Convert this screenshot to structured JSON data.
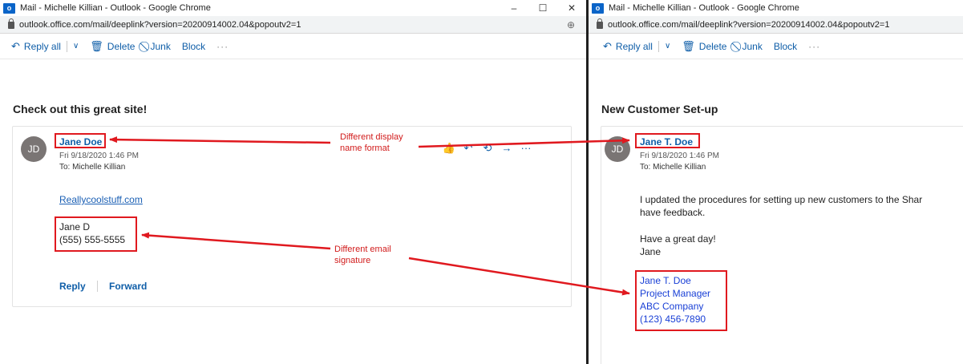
{
  "left": {
    "window_title": "Mail - Michelle Killian - Outlook - Google Chrome",
    "app_icon_text": "o",
    "controls": [
      "–",
      "☐",
      "✕"
    ],
    "url": "outlook.office.com/mail/deeplink?version=20200914002.04&popoutv2=1",
    "toolbar": {
      "reply_all": "Reply all",
      "delete": "Delete",
      "junk": "Junk",
      "block": "Block",
      "more": "···"
    },
    "subject": "Check out this great site!",
    "avatar": "JD",
    "sender": "Jane Doe",
    "date": "Fri 9/18/2020 1:46 PM",
    "to": "To:  Michelle Killian",
    "link": "Reallycoolstuff.com",
    "signature": [
      "Jane D",
      "(555) 555-5555"
    ],
    "reply": "Reply",
    "forward": "Forward"
  },
  "right": {
    "window_title": "Mail - Michelle Killian - Outlook - Google Chrome",
    "app_icon_text": "o",
    "url": "outlook.office.com/mail/deeplink?version=20200914002.04&popoutv2=1",
    "toolbar": {
      "reply_all": "Reply all",
      "delete": "Delete",
      "junk": "Junk",
      "block": "Block",
      "more": "···"
    },
    "subject": "New Customer Set-up",
    "avatar": "JD",
    "sender": "Jane T. Doe",
    "date": "Fri 9/18/2020 1:46 PM",
    "to": "To:  Michelle Killian",
    "body": [
      "I updated the procedures for setting up new customers to the Shar",
      "have feedback."
    ],
    "closing": [
      "Have a great day!",
      "Jane"
    ],
    "signature": [
      "Jane T. Doe",
      "Project Manager",
      "ABC Company",
      "(123) 456-7890"
    ]
  },
  "annotations": {
    "display_name": [
      "Different display",
      "name format"
    ],
    "signature": [
      "Different email",
      "signature"
    ]
  },
  "colors": {
    "annotation": "#e0191f",
    "outlook_blue": "#0f5ea8"
  }
}
